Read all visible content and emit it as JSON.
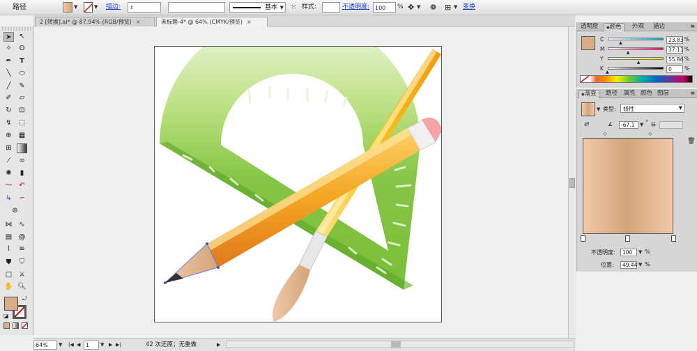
{
  "control_bar": {
    "object_type": "路径",
    "stroke_label": "描边:",
    "stroke_weight": "",
    "stroke_profile": "",
    "brush": "基本",
    "style_label": "样式:",
    "opacity_label": "不透明度:",
    "opacity_value": "100",
    "percent": "%",
    "transform_label": "变换"
  },
  "tabs": [
    {
      "label": "2 [转换].ai* @ 87.94% (RGB/预览)",
      "close": "×"
    },
    {
      "label": "未标题-4* @ 64% (CMYK/预览)",
      "close": "×"
    }
  ],
  "status": {
    "zoom": "64%",
    "page": "1",
    "message": "42 次还原；无重做"
  },
  "color_panel": {
    "tabs": [
      "透明度",
      "颜色",
      "外观",
      "描边"
    ],
    "channels": [
      {
        "label": "C",
        "value": "23.83",
        "percent": "%",
        "fraction": 0.2383
      },
      {
        "label": "M",
        "value": "37.11",
        "percent": "%",
        "fraction": 0.3711
      },
      {
        "label": "Y",
        "value": "55.86",
        "percent": "%",
        "fraction": 0.5586
      },
      {
        "label": "K",
        "value": "0",
        "percent": "%",
        "fraction": 0
      }
    ]
  },
  "gradient_panel": {
    "tabs": [
      "渐变",
      "路径",
      "属性",
      "颜色",
      "图层"
    ],
    "type_label": "类型:",
    "type_value": "线性",
    "angle_value": "-67.1",
    "degree": "°",
    "opacity_label": "不透明度:",
    "opacity_value": "100",
    "position_label": "位置:",
    "position_value": "49.44",
    "percent": "%",
    "stop_positions": [
      0,
      0.4944,
      1
    ]
  },
  "colors": {
    "fill": "#d6ad85",
    "gradient_light": "#f2c8a8",
    "gradient_dark": "#d1a57a",
    "protractor_green": "#7ec23a",
    "pencil_orange": "#f5a623",
    "brush_yellow": "#f8c21c"
  }
}
